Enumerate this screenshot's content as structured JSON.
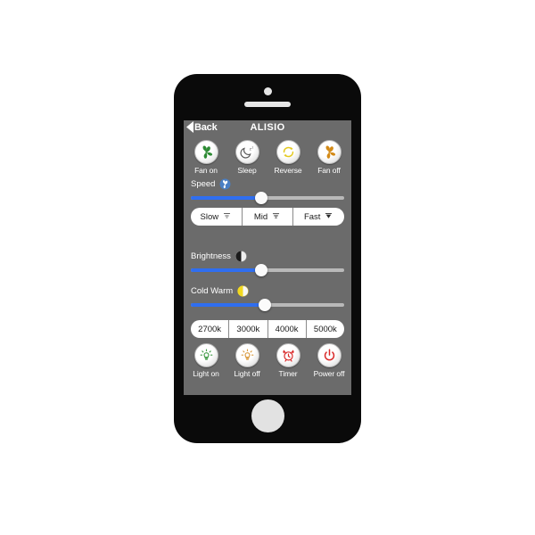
{
  "app": {
    "screen_bg": "#6b6b6b",
    "accent": "#2f6ef0",
    "device_frame": "#0a0a0a"
  },
  "navbar": {
    "back_label": "Back",
    "title": "ALISIO",
    "back_icon": "chevron-left-icon"
  },
  "fan_controls": [
    {
      "label": "Fan on",
      "icon": "fan-icon",
      "color": "#2e8b35"
    },
    {
      "label": "Sleep",
      "icon": "moon-sleep-icon",
      "color": "#6d6d6d"
    },
    {
      "label": "Reverse",
      "icon": "rotate-arrows-icon",
      "color": "#e8d33a"
    },
    {
      "label": "Fan off",
      "icon": "fan-icon",
      "color": "#d38a17"
    }
  ],
  "speed": {
    "label": "Speed",
    "icon": "fan-speed-icon",
    "value_percent": 46,
    "fill_color": "#2f6ef0",
    "track_color": "#b9b9b9"
  },
  "speed_presets": [
    {
      "label": "Slow",
      "icon": "wave-light-icon"
    },
    {
      "label": "Mid",
      "icon": "wave-medium-icon"
    },
    {
      "label": "Fast",
      "icon": "wave-strong-icon"
    }
  ],
  "brightness": {
    "label": "Brightness",
    "icon": "half-circle-contrast-icon",
    "value_percent": 46,
    "fill_color": "#2f6ef0",
    "track_color": "#b9b9b9"
  },
  "cold_warm": {
    "label": "Cold Warm",
    "icon": "half-circle-warm-icon",
    "value_percent": 48,
    "fill_color": "#2f6ef0",
    "track_color": "#b9b9b9"
  },
  "color_temperatures": [
    {
      "label": "2700k"
    },
    {
      "label": "3000k"
    },
    {
      "label": "4000k"
    },
    {
      "label": "5000k"
    }
  ],
  "light_controls": [
    {
      "label": "Light on",
      "icon": "bulb-icon",
      "color": "#3f9b44"
    },
    {
      "label": "Light off",
      "icon": "bulb-icon",
      "color": "#d99a3c"
    },
    {
      "label": "Timer",
      "icon": "alarm-clock-icon",
      "color": "#d92b2b"
    },
    {
      "label": "Power off",
      "icon": "power-icon",
      "color": "#d92b2b"
    }
  ]
}
